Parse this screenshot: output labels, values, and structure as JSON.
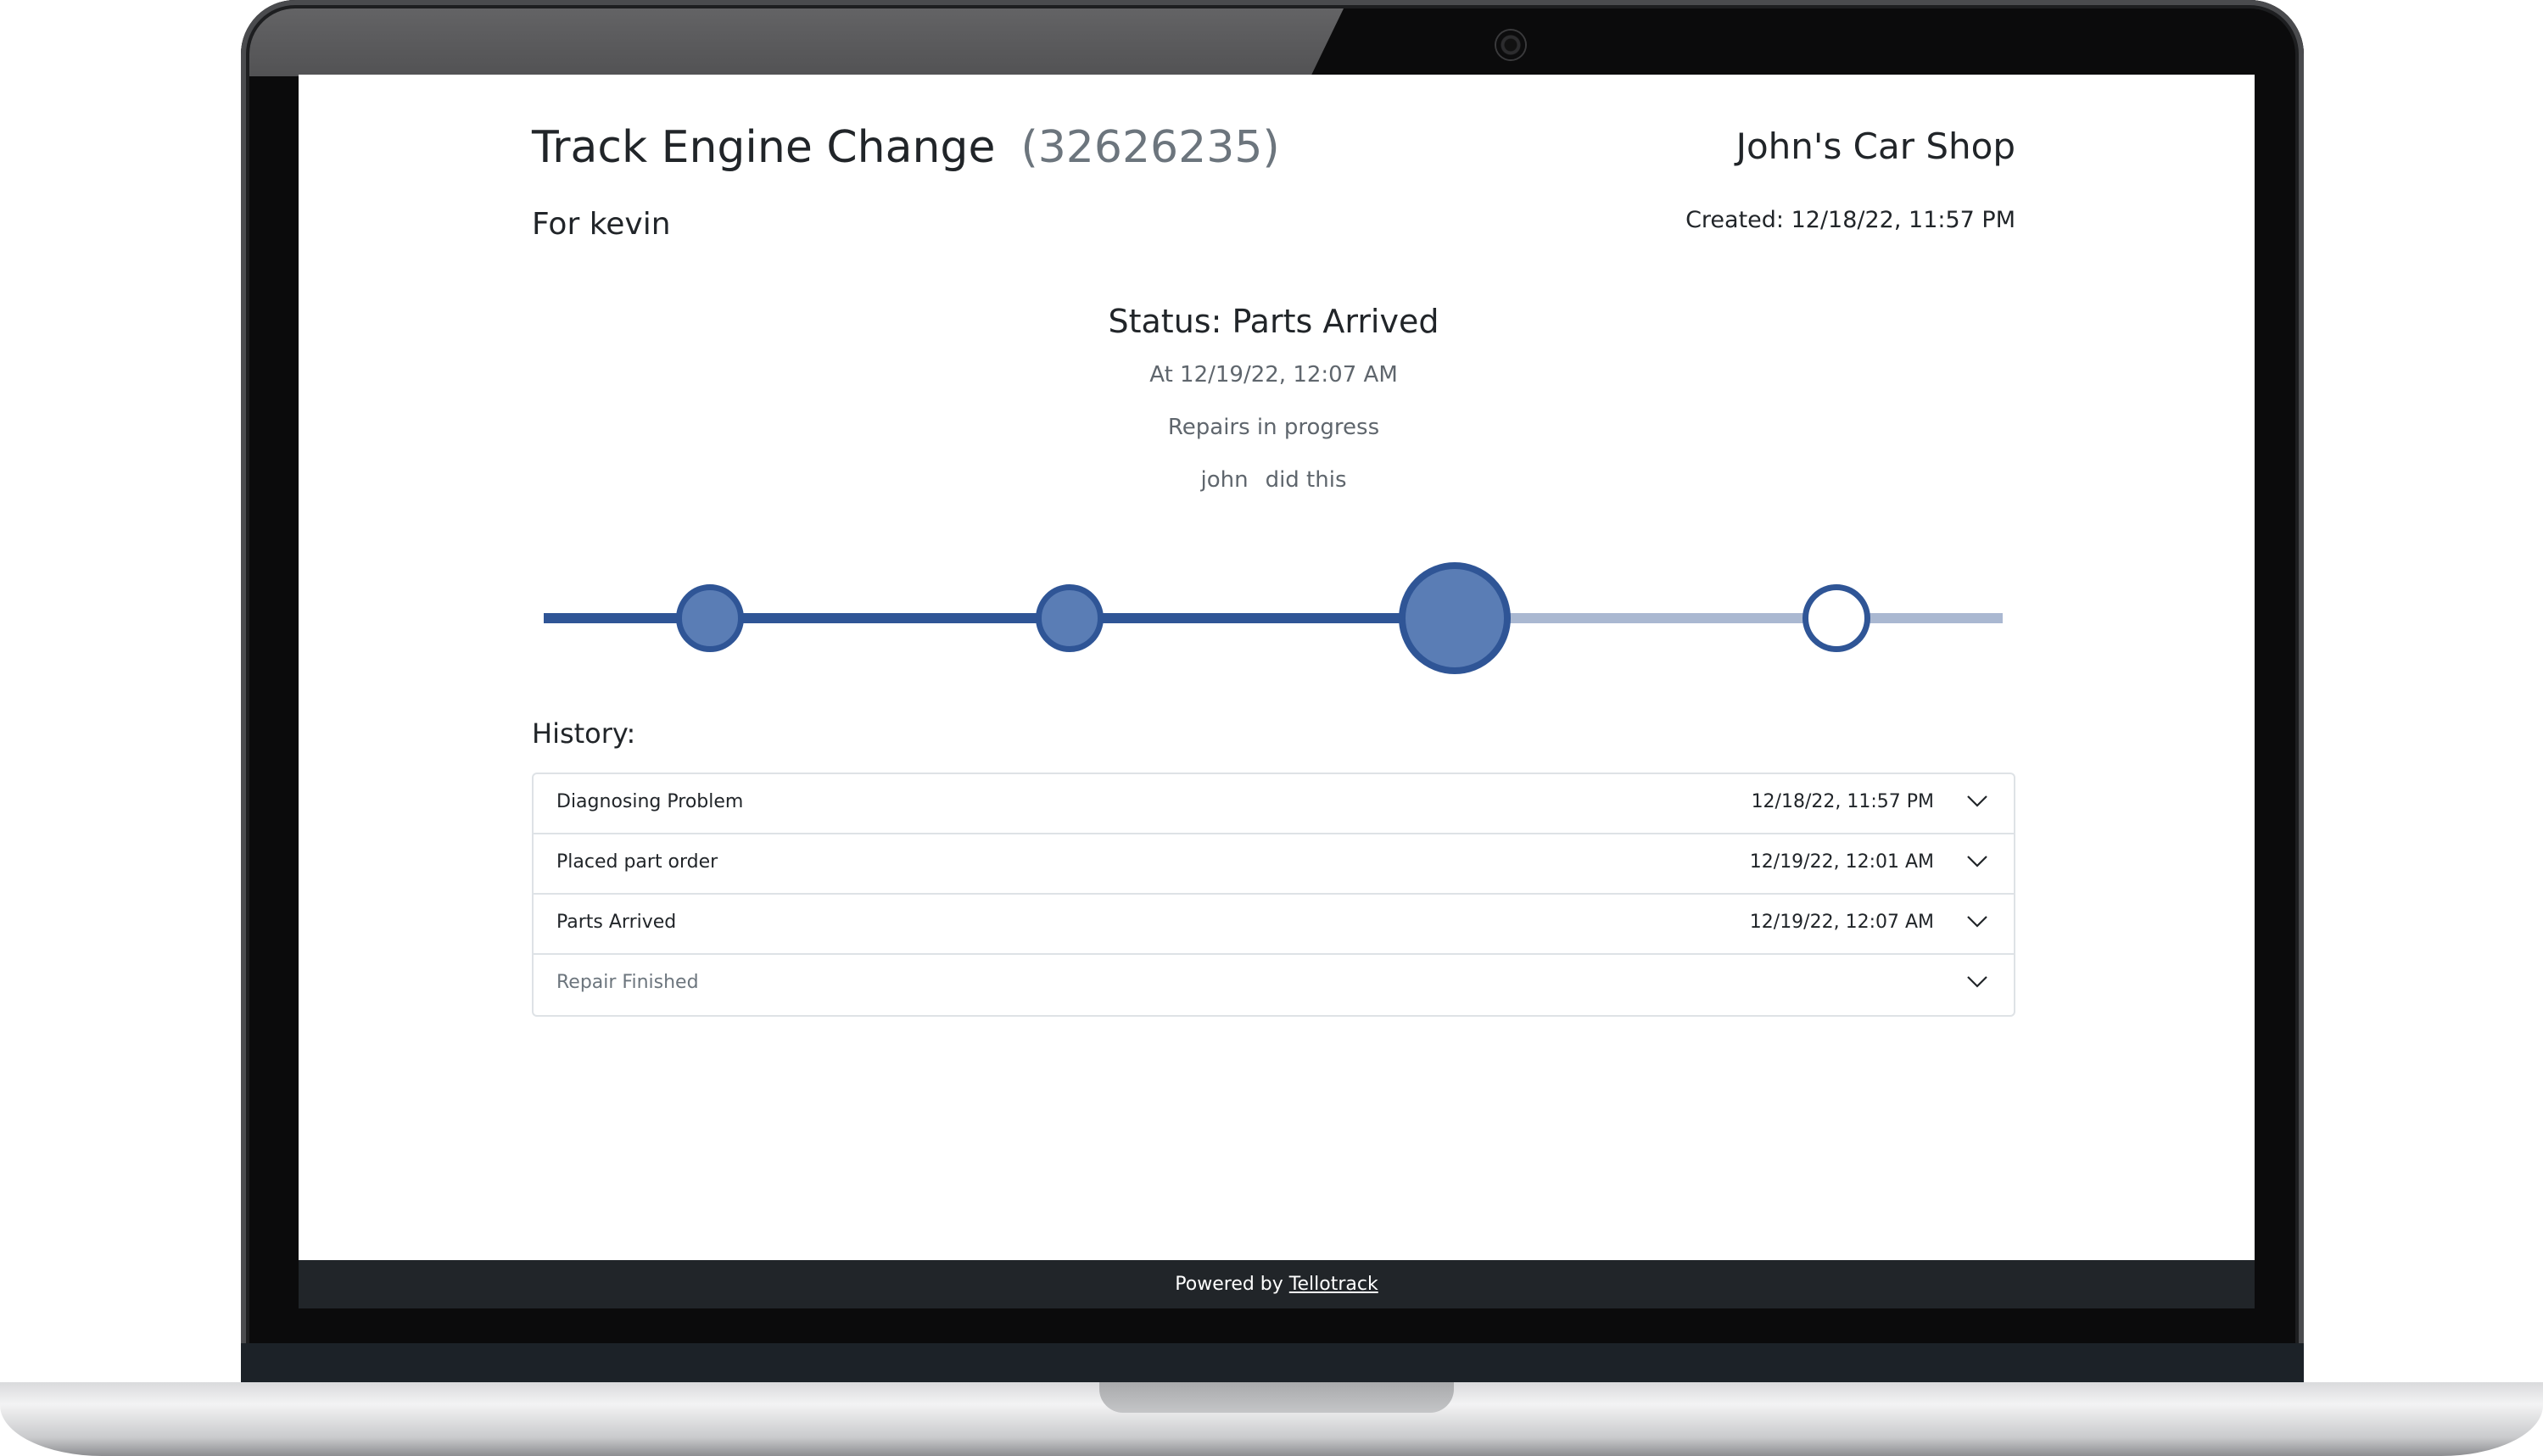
{
  "header": {
    "title": "Track Engine Change",
    "tracking_id": "(32626235)",
    "customer": "For kevin",
    "shop_name": "John's Car Shop",
    "created": "Created: 12/18/22, 11:57 PM"
  },
  "status": {
    "heading": "Status: Parts Arrived",
    "time": "At 12/19/22, 12:07 AM",
    "description": "Repairs in progress",
    "actor": "john",
    "actor_suffix": "did this"
  },
  "progress": {
    "total_steps": 4,
    "current_step": 3,
    "colors": {
      "done": "#2f5596",
      "pending": "#aab8d1",
      "node_fill": "#5a7db5"
    }
  },
  "history": {
    "label": "History:",
    "items": [
      {
        "name": "Diagnosing Problem",
        "date": "12/18/22, 11:57 PM",
        "icon": "chevron-down-icon"
      },
      {
        "name": "Placed part order",
        "date": "12/19/22, 12:01 AM",
        "icon": "chevron-down-icon"
      },
      {
        "name": "Parts Arrived",
        "date": "12/19/22, 12:07 AM",
        "icon": "chevron-down-icon"
      },
      {
        "name": "Repair Finished",
        "date": "",
        "icon": "chevron-down-icon"
      }
    ]
  },
  "footer": {
    "prefix": "Powered by",
    "link_label": "Tellotrack"
  }
}
